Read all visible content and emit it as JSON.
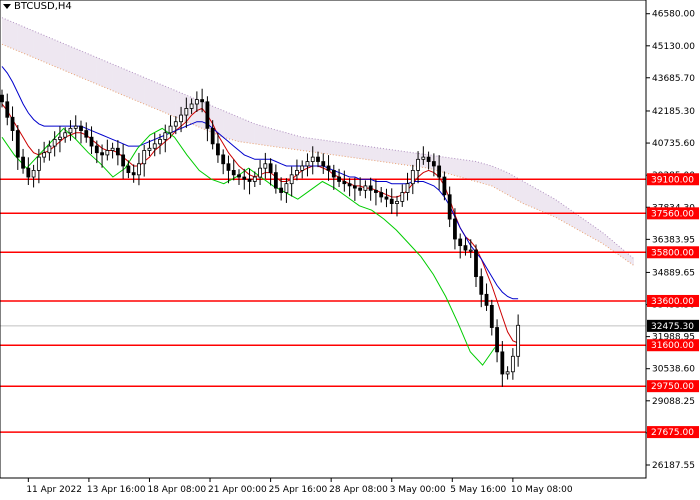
{
  "header": {
    "symbol": "BTCUSD,H4"
  },
  "chart_data": {
    "type": "candlestick",
    "title": "BTCUSD,H4",
    "ylim": [
      25600,
      47200
    ],
    "xlim": [
      0,
      120
    ],
    "price_ticks": [
      "46580.00",
      "45130.00",
      "43685.70",
      "42185.30",
      "40735.60",
      "39285.00",
      "37834.30",
      "36383.95",
      "34889.65",
      "33433.30",
      "31988.95",
      "30538.60",
      "29088.25",
      "27637.90",
      "26187.55"
    ],
    "price_tick_values": [
      46580,
      45130,
      43685.7,
      42185.3,
      40735.6,
      39285,
      37834.3,
      36383.95,
      34889.65,
      33433.3,
      31988.95,
      30538.6,
      29088.25,
      27637.9,
      26187.55
    ],
    "date_ticks": [
      {
        "label": "11 Apr 2022",
        "x": 5
      },
      {
        "label": "13 Apr 16:00",
        "x": 16.5
      },
      {
        "label": "18 Apr 08:00",
        "x": 28
      },
      {
        "label": "21 Apr 00:00",
        "x": 39.5
      },
      {
        "label": "25 Apr 16:00",
        "x": 51
      },
      {
        "label": "28 Apr 08:00",
        "x": 62.5
      },
      {
        "label": "3 May 00:00",
        "x": 74
      },
      {
        "label": "5 May 16:00",
        "x": 85.5
      },
      {
        "label": "10 May 08:00",
        "x": 97
      }
    ],
    "current_price": {
      "label": "32475.30",
      "value": 32475.3
    },
    "levels": [
      {
        "label": "39100.00",
        "value": 39100
      },
      {
        "label": "37560.00",
        "value": 37560
      },
      {
        "label": "35800.00",
        "value": 35800
      },
      {
        "label": "33600.00",
        "value": 33600
      },
      {
        "label": "31600.00",
        "value": 31600
      },
      {
        "label": "29750.00",
        "value": 29750
      },
      {
        "label": "27675.00",
        "value": 27675
      }
    ],
    "colors": {
      "candle": "#000000",
      "level": "#ff0000",
      "tenkan": "#cc0000",
      "kijun": "#0000cc",
      "chikou": "#00cc00",
      "senkou_a": "#e8a070",
      "senkou_b": "#b090c0",
      "current": "#c0c0c0"
    },
    "series": [
      {
        "x": [
          0,
          1,
          2,
          3,
          4,
          5,
          6,
          7,
          8,
          9,
          10,
          11,
          12,
          13,
          14,
          15,
          16,
          17,
          18,
          19,
          20,
          21,
          22,
          23,
          24,
          25,
          26,
          27,
          28,
          29,
          30,
          31,
          32,
          33,
          34,
          35,
          36,
          37,
          38,
          39,
          40,
          41,
          42,
          43,
          44,
          45,
          46,
          47,
          48,
          49,
          50,
          51,
          52,
          53,
          54,
          55,
          56,
          57,
          58,
          59,
          60,
          61,
          62,
          63,
          64,
          65,
          66,
          67,
          68,
          69,
          70,
          71,
          72,
          73,
          74,
          75,
          76,
          77,
          78,
          79,
          80,
          81,
          82,
          83,
          84,
          85,
          86,
          87,
          88,
          89,
          90,
          91,
          92,
          93,
          94,
          95,
          96,
          97,
          98
        ],
        "open": [
          42900,
          42600,
          41900,
          41300,
          40100,
          39600,
          39200,
          39500,
          40100,
          40300,
          40600,
          40900,
          41000,
          41200,
          41400,
          41500,
          41300,
          41000,
          40600,
          40300,
          40200,
          40400,
          40500,
          40200,
          39700,
          39400,
          39300,
          39800,
          40400,
          40500,
          40700,
          40900,
          41200,
          41500,
          41700,
          42000,
          42300,
          42500,
          42700,
          42600,
          41400,
          40700,
          40200,
          39800,
          39500,
          39300,
          39200,
          39100,
          39000,
          39200,
          39600,
          39800,
          39400,
          38700,
          38500,
          38900,
          39300,
          39500,
          39700,
          39900,
          40100,
          39900,
          39700,
          39500,
          39200,
          39000,
          38900,
          38800,
          38700,
          38600,
          38800,
          38600,
          38500,
          38300,
          38200,
          38000,
          38100,
          38500,
          38900,
          39500,
          40000,
          40100,
          39900,
          39700,
          39200,
          38400,
          37300,
          36400,
          36100,
          35900,
          35900,
          34700,
          33900,
          33400,
          32400,
          31300,
          30300,
          30400,
          31100
        ],
        "close": [
          42600,
          41900,
          41300,
          40100,
          39600,
          39200,
          39500,
          40100,
          40300,
          40600,
          40900,
          41000,
          41200,
          41400,
          41500,
          41300,
          41000,
          40600,
          40300,
          40200,
          40400,
          40500,
          40200,
          39700,
          39400,
          39300,
          39800,
          40400,
          40500,
          40700,
          40900,
          41200,
          41500,
          41700,
          42000,
          42300,
          42500,
          42700,
          42600,
          41400,
          40700,
          40200,
          39800,
          39500,
          39300,
          39200,
          39100,
          39000,
          39200,
          39600,
          39800,
          39400,
          38700,
          38500,
          38900,
          39300,
          39500,
          39700,
          39900,
          40100,
          39900,
          39700,
          39500,
          39200,
          39000,
          38900,
          38800,
          38700,
          38600,
          38800,
          38600,
          38500,
          38300,
          38200,
          38000,
          38100,
          38500,
          38900,
          39500,
          40000,
          40100,
          39900,
          39700,
          39200,
          38400,
          37300,
          36400,
          36100,
          35900,
          35900,
          34700,
          33900,
          33400,
          32400,
          31300,
          30300,
          30400,
          31100,
          32500
        ],
        "tenkan": [
          42500,
          42200,
          41800,
          41400,
          41000,
          40600,
          40300,
          40200,
          40300,
          40400,
          40600,
          40800,
          41000,
          41100,
          41200,
          41200,
          41100,
          40900,
          40700,
          40500,
          40400,
          40400,
          40300,
          40100,
          39900,
          39700,
          39700,
          39900,
          40100,
          40400,
          40600,
          40800,
          41000,
          41300,
          41500,
          41700,
          42000,
          42200,
          42300,
          42000,
          41600,
          41100,
          40700,
          40300,
          40000,
          39700,
          39500,
          39300,
          39200,
          39300,
          39400,
          39400,
          39200,
          39000,
          39000,
          39100,
          39300,
          39500,
          39600,
          39700,
          39700,
          39600,
          39500,
          39300,
          39200,
          39000,
          38900,
          38800,
          38800,
          38700,
          38700,
          38600,
          38500,
          38400,
          38300,
          38300,
          38400,
          38600,
          38900,
          39200,
          39400,
          39500,
          39400,
          39200,
          38800,
          38200,
          37500,
          36900,
          36500,
          36300,
          36000,
          35500,
          34900,
          34300,
          33600,
          32900,
          32200,
          31800,
          31700
        ],
        "kijun": [
          44200,
          43900,
          43500,
          43000,
          42500,
          42100,
          41800,
          41600,
          41500,
          41500,
          41500,
          41500,
          41500,
          41500,
          41500,
          41500,
          41400,
          41300,
          41200,
          41100,
          41000,
          40900,
          40800,
          40700,
          40600,
          40600,
          40600,
          40700,
          40800,
          40900,
          41000,
          41100,
          41200,
          41300,
          41400,
          41500,
          41600,
          41700,
          41700,
          41600,
          41400,
          41200,
          41000,
          40800,
          40600,
          40400,
          40200,
          40100,
          40000,
          40000,
          40000,
          40000,
          39900,
          39800,
          39700,
          39700,
          39700,
          39700,
          39700,
          39700,
          39700,
          39700,
          39600,
          39500,
          39400,
          39300,
          39200,
          39200,
          39100,
          39100,
          39100,
          39000,
          39000,
          39000,
          38900,
          38900,
          38900,
          38900,
          39000,
          39000,
          39000,
          38900,
          38800,
          38600,
          38300,
          37900,
          37400,
          36900,
          36500,
          36100,
          35800,
          35500,
          35100,
          34700,
          34300,
          34000,
          33800,
          33700,
          33700
        ],
        "chikou_x": [
          0,
          3,
          6,
          9,
          12,
          15,
          18,
          21,
          24,
          27,
          30,
          33,
          36,
          39,
          42,
          45,
          48,
          51,
          54,
          57,
          60,
          63,
          66,
          69,
          72,
          75,
          78,
          81,
          84,
          87,
          90,
          93,
          96,
          99,
          102,
          105,
          108,
          111,
          114,
          117,
          120
        ],
        "chikou": [
          41000,
          40200,
          39600,
          40200,
          40800,
          41400,
          40900,
          40300,
          39800,
          39200,
          39600,
          40500,
          41100,
          41400,
          41000,
          40200,
          39500,
          39100,
          38900,
          39200,
          39600,
          39200,
          38800,
          38500,
          38200,
          38600,
          39000,
          38700,
          38300,
          37900,
          37700,
          37300,
          36800,
          36200,
          35600,
          34800,
          33800,
          32600,
          31300,
          30700,
          31500
        ],
        "senkou_a": [
          45200,
          44900,
          44600,
          44300,
          44000,
          43700,
          43400,
          43100,
          42800,
          42500,
          42200,
          41900,
          41600,
          41300,
          41000,
          40800,
          40700,
          40600,
          40500,
          40400,
          40300,
          40200,
          40100,
          40000,
          39900,
          39800,
          39700,
          39600,
          39400,
          39200,
          39000,
          38800,
          38400,
          38000,
          37700,
          37400,
          37000,
          36600,
          36200,
          35700,
          35200
        ],
        "senkou_b": [
          46400,
          46100,
          45800,
          45500,
          45200,
          44900,
          44600,
          44300,
          44000,
          43700,
          43400,
          43100,
          42800,
          42500,
          42200,
          41900,
          41600,
          41400,
          41200,
          41000,
          40900,
          40800,
          40700,
          40600,
          40500,
          40400,
          40300,
          40200,
          40100,
          40000,
          39900,
          39700,
          39400,
          39000,
          38600,
          38200,
          37700,
          37200,
          36700,
          36100,
          35500
        ]
      }
    ]
  }
}
